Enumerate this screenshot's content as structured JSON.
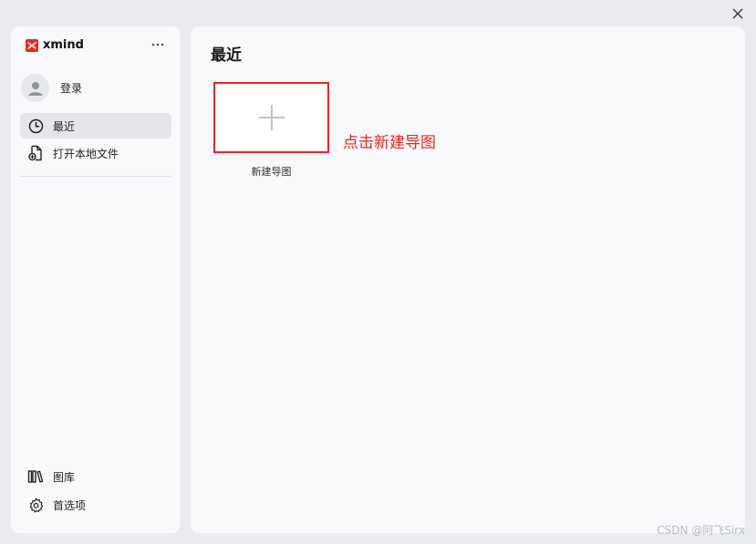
{
  "window": {
    "close_icon": "close-icon"
  },
  "sidebar": {
    "logo_text": "xmind",
    "more_icon": "more-horizontal-icon",
    "login_label": "登录",
    "items": [
      {
        "label": "最近",
        "icon": "clock-icon",
        "active": true
      },
      {
        "label": "打开本地文件",
        "icon": "file-open-icon",
        "active": false
      }
    ],
    "bottom_items": [
      {
        "label": "图库",
        "icon": "library-icon"
      },
      {
        "label": "首选项",
        "icon": "gear-icon"
      }
    ]
  },
  "main": {
    "title": "最近",
    "new_map_label": "新建导图",
    "annotation": "点击新建导图"
  },
  "watermark": "CSDN @阿飞Sirx",
  "colors": {
    "accent_red": "#e8261f",
    "logo_red": "#e8261f"
  }
}
